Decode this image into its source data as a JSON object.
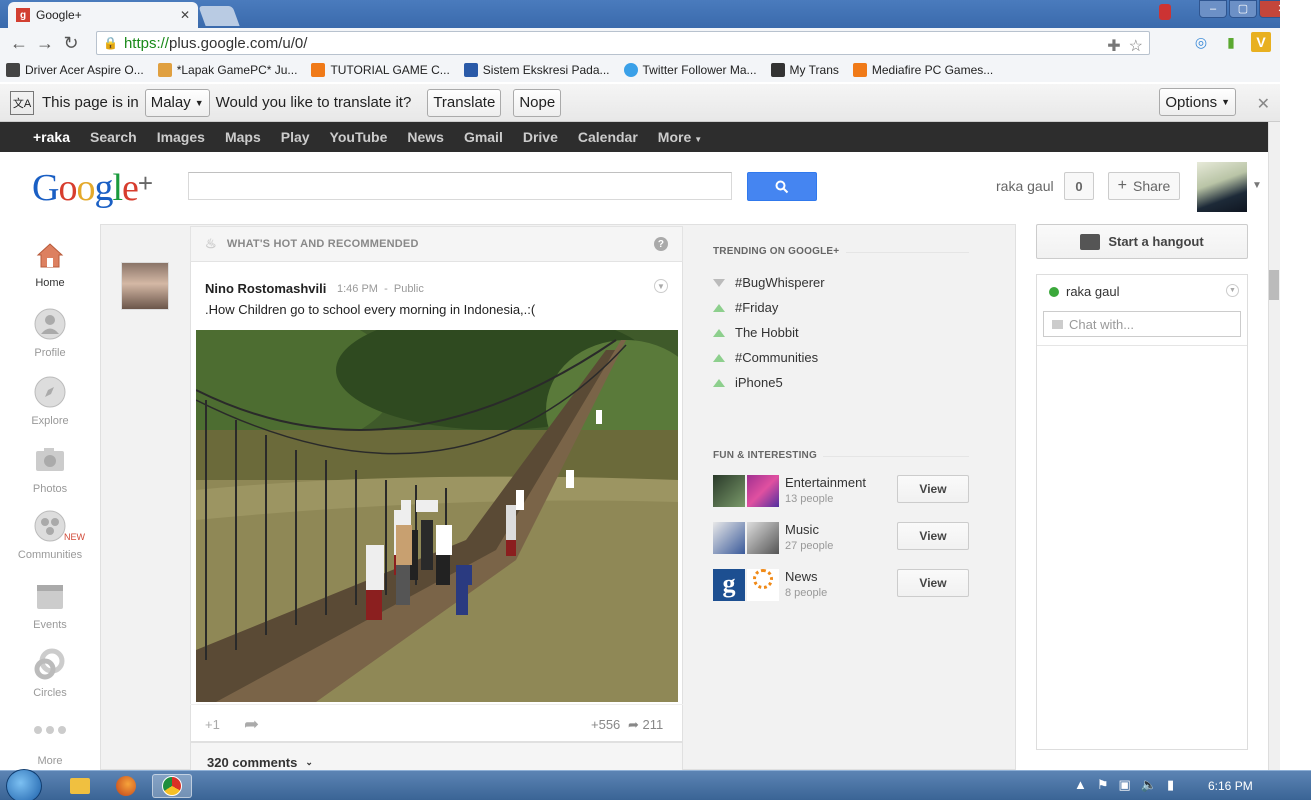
{
  "browser": {
    "tab_title": "Google+",
    "url_https": "https://",
    "url_rest": "plus.google.com/u/0/",
    "bookmarks": [
      {
        "label": "Driver Acer Aspire O...",
        "color": "#444444"
      },
      {
        "label": "*Lapak GamePC* Ju...",
        "color": "#e0a040"
      },
      {
        "label": "TUTORIAL GAME C...",
        "color": "#f07a18"
      },
      {
        "label": "Sistem Ekskresi Pada...",
        "color": "#2a5aa8"
      },
      {
        "label": "Twitter Follower Ma...",
        "color": "#3aa0e8"
      },
      {
        "label": "My Trans",
        "color": "#333333"
      },
      {
        "label": "Mediafire PC Games...",
        "color": "#f07a18"
      }
    ]
  },
  "translate_bar": {
    "prefix": "This page is in",
    "language": "Malay",
    "question": "Would you like to translate it?",
    "translate_label": "Translate",
    "nope_label": "Nope",
    "options_label": "Options"
  },
  "gbar": {
    "items": [
      "+raka",
      "Search",
      "Images",
      "Maps",
      "Play",
      "YouTube",
      "News",
      "Gmail",
      "Drive",
      "Calendar",
      "More"
    ]
  },
  "header": {
    "user_name": "raka gaul",
    "notification_count": "0",
    "share_label": "Share"
  },
  "leftnav": {
    "items": [
      "Home",
      "Profile",
      "Explore",
      "Photos",
      "Communities",
      "Events",
      "Circles",
      "More"
    ],
    "new_badge": "NEW"
  },
  "post": {
    "section_title": "WHAT'S HOT AND RECOMMENDED",
    "author": "Nino Rostomashvili",
    "time": "1:46 PM",
    "visibility": "Public",
    "text": ".How Children go to school every morning in Indonesia,.:(",
    "plusone_label": "+1",
    "plus_count": "+556",
    "share_count": "211",
    "comments_label": "320 comments"
  },
  "trending": {
    "title": "TRENDING ON GOOGLE+",
    "items": [
      {
        "label": "#BugWhisperer",
        "direction": "down"
      },
      {
        "label": "#Friday",
        "direction": "up"
      },
      {
        "label": "The Hobbit",
        "direction": "up"
      },
      {
        "label": "#Communities",
        "direction": "up"
      },
      {
        "label": "iPhone5",
        "direction": "up"
      }
    ]
  },
  "fun": {
    "title": "FUN & INTERESTING",
    "communities": [
      {
        "name": "Entertainment",
        "sub": "13 people",
        "view_label": "View"
      },
      {
        "name": "Music",
        "sub": "27 people",
        "view_label": "View"
      },
      {
        "name": "News",
        "sub": "8 people",
        "view_label": "View"
      }
    ]
  },
  "chat": {
    "hangout_label": "Start a hangout",
    "user": "raka gaul",
    "placeholder": "Chat with..."
  },
  "taskbar": {
    "clock": "6:16 PM"
  },
  "colors": {
    "gbar_bg": "#2d2d2d",
    "search_blue": "#4585f1",
    "trend_up": "#8dcf8d",
    "new_red": "#d14836"
  }
}
